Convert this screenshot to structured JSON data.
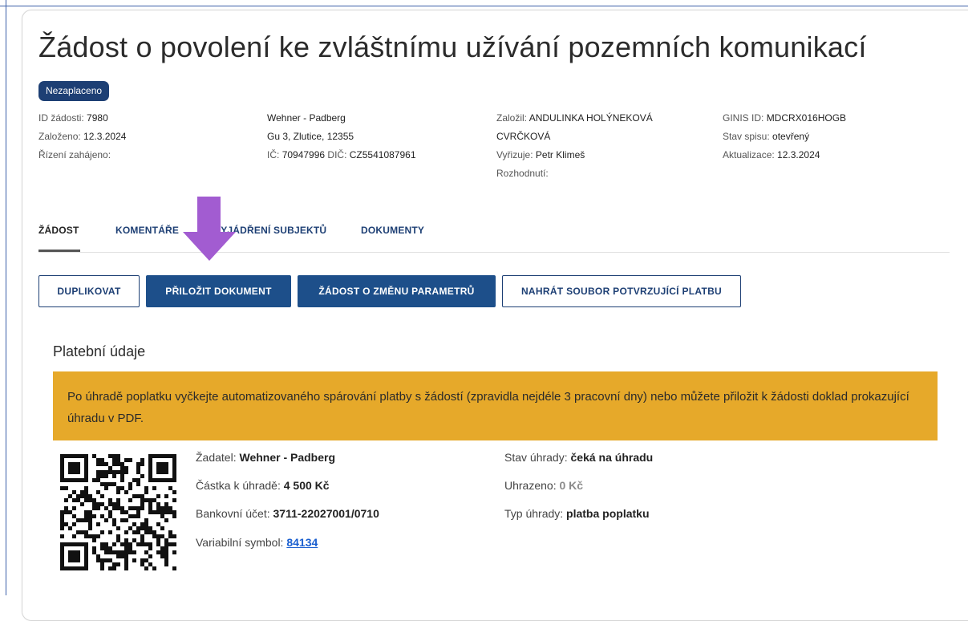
{
  "header": {
    "title": "Žádost o povolení ke zvláštnímu užívání pozemních komunikací",
    "status_badge": "Nezaplaceno"
  },
  "meta": {
    "col1": [
      {
        "label": "ID žádosti:",
        "value": "7980"
      },
      {
        "label": "Založeno:",
        "value": "12.3.2024"
      },
      {
        "label": "Řízení zahájeno:",
        "value": ""
      }
    ],
    "col2": {
      "name": "Wehner - Padberg",
      "address": "Gu 3, Zlutice, 12355",
      "ic_label": "IČ:",
      "ic_value": "70947996",
      "dic_label": "DIČ:",
      "dic_value": "CZ5541087961"
    },
    "col3": {
      "zalozil_label": "Založil:",
      "zalozil_value_line1": "ANDULINKA HOLÝNEKOVÁ",
      "zalozil_value_line2": "CVRČKOVÁ",
      "vyrizuje_label": "Vyřizuje:",
      "vyrizuje_value": "Petr Klimeš",
      "rozhodnuti_label": "Rozhodnutí:",
      "rozhodnuti_value": ""
    },
    "col4": [
      {
        "label": "GINIS ID:",
        "value": "MDCRX016HOGB"
      },
      {
        "label": "Stav spisu:",
        "value": "otevřený"
      },
      {
        "label": "Aktualizace:",
        "value": "12.3.2024"
      }
    ]
  },
  "tabs": [
    {
      "label": "ŽÁDOST",
      "active": true
    },
    {
      "label": "KOMENTÁŘE",
      "active": false
    },
    {
      "label": "VYJÁDŘENÍ SUBJEKTŮ",
      "active": false
    },
    {
      "label": "DOKUMENTY",
      "active": false
    }
  ],
  "actions": {
    "duplicate": "DUPLIKOVAT",
    "attach": "PŘILOŽIT DOKUMENT",
    "change_params": "ŽÁDOST O ZMĚNU PARAMETRŮ",
    "upload_payment": "NAHRÁT SOUBOR POTVRZUJÍCÍ PLATBU"
  },
  "payment": {
    "section_title": "Platební údaje",
    "notice": "Po úhradě poplatku vyčkejte automatizovaného spárování platby s žádostí (zpravidla nejdéle 3 pracovní dny) nebo můžete přiložit k žádosti doklad prokazující úhradu v PDF.",
    "left": [
      {
        "label": "Žadatel:",
        "value": "Wehner - Padberg"
      },
      {
        "label": "Částka k úhradě:",
        "value": "4 500 Kč"
      },
      {
        "label": "Bankovní účet:",
        "value": "3711-22027001/0710"
      }
    ],
    "variable_symbol_label": "Variabilní symbol:",
    "variable_symbol_value": "84134",
    "right": [
      {
        "label": "Stav úhrady:",
        "value": "čeká na úhradu"
      },
      {
        "label": "Uhrazeno:",
        "value": "0 Kč"
      },
      {
        "label": "Typ úhrady:",
        "value": "platba poplatku"
      }
    ]
  },
  "colors": {
    "primary": "#1d4f8a",
    "badge": "#1d3f74",
    "notice": "#e6a92a",
    "arrow": "#a25cd1",
    "link": "#1a5fd0"
  }
}
